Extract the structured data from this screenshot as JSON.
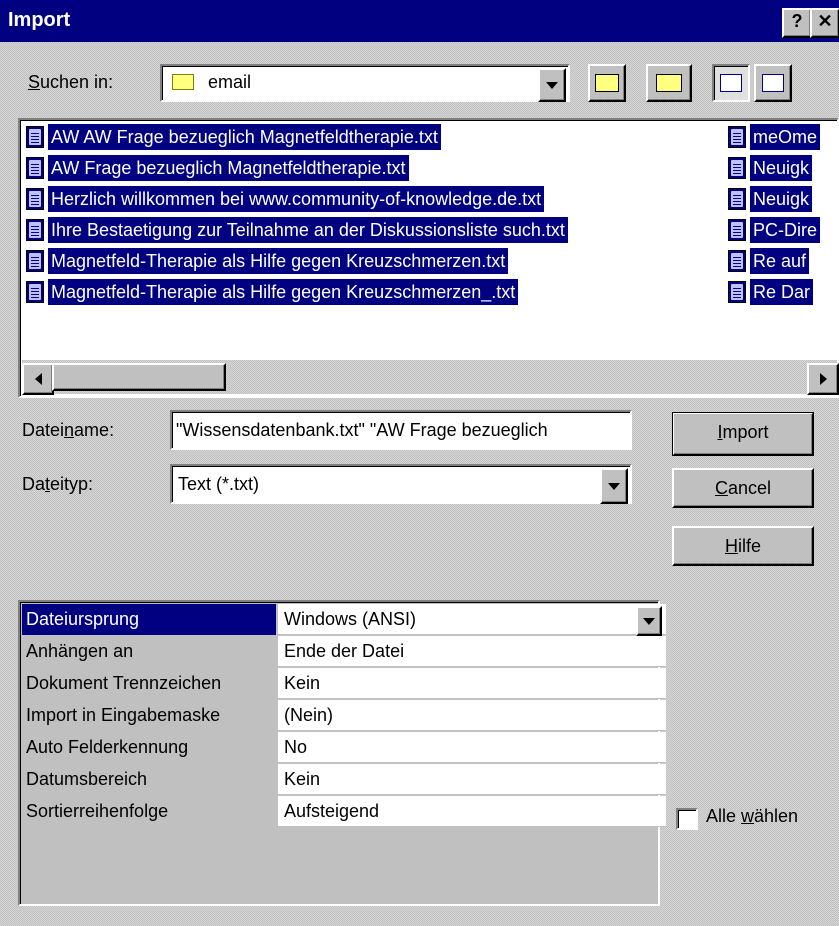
{
  "window": {
    "title": "Import",
    "help_btn": "?",
    "close_btn": "✕"
  },
  "lookin": {
    "label_pre": "",
    "label_key": "S",
    "label_post": "uchen in:",
    "folder": "email"
  },
  "toolbar": {
    "icons": [
      "up-folder-icon",
      "new-folder-icon",
      "list-view-icon",
      "details-view-icon"
    ]
  },
  "files_left": [
    "AW AW Frage bezueglich Magnetfeldtherapie.txt",
    "AW Frage bezueglich Magnetfeldtherapie.txt",
    "Herzlich willkommen bei www.community-of-knowledge.de.txt",
    "Ihre Bestaetigung zur Teilnahme an der Diskussionsliste such.txt",
    "Magnetfeld-Therapie als Hilfe gegen Kreuzschmerzen.txt",
    "Magnetfeld-Therapie als Hilfe gegen Kreuzschmerzen_.txt"
  ],
  "files_right": [
    "meOme",
    "Neuigk",
    "Neuigk",
    "PC-Dire",
    "Re auf",
    "Re Dar"
  ],
  "filename": {
    "label_pre": "Datei",
    "label_key": "n",
    "label_post": "ame:",
    "value": "\"Wissensdatenbank.txt\" \"AW Frage bezueglich"
  },
  "filetype": {
    "label_pre": "Da",
    "label_key": "t",
    "label_post": "eityp:",
    "value": "Text (*.txt)"
  },
  "buttons": {
    "import": {
      "pre": "",
      "key": "I",
      "post": "mport"
    },
    "cancel": {
      "pre": "",
      "key": "C",
      "post": "ancel"
    },
    "help": {
      "pre": "",
      "key": "H",
      "post": "ilfe"
    }
  },
  "options": [
    {
      "name": "Dateiursprung",
      "value": "Windows (ANSI)"
    },
    {
      "name": "Anhängen an",
      "value": "Ende der Datei"
    },
    {
      "name": "Dokument Trennzeichen",
      "value": "Kein"
    },
    {
      "name": "Import in Eingabemaske",
      "value": "(Nein)"
    },
    {
      "name": "Auto Felderkennung",
      "value": "No"
    },
    {
      "name": "Datumsbereich",
      "value": " Kein"
    },
    {
      "name": "Sortierreihenfolge",
      "value": "Aufsteigend"
    }
  ],
  "select_all": {
    "pre": "Alle ",
    "key": "w",
    "post": "ählen",
    "checked": false
  }
}
